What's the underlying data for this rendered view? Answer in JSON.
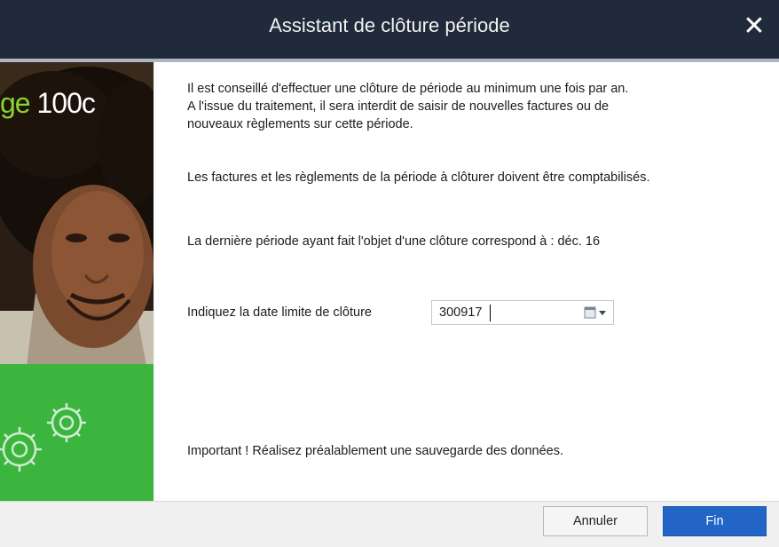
{
  "window": {
    "title": "Assistant de clôture période",
    "close_icon": "close-icon"
  },
  "sidebar": {
    "brand_accent": "ge",
    "brand_rest": " 100c",
    "accent_color": "#8bd42f",
    "panel_color": "#3cb53f"
  },
  "content": {
    "intro": "Il est conseillé d'effectuer une clôture de période au minimum une fois par an.\nA l'issue du traitement, il sera interdit de saisir de nouvelles factures ou de\nnouveaux règlements sur cette période.",
    "requirement": "Les factures et les règlements de la période à clôturer doivent être comptabilisés.",
    "last_closure": "La dernière période ayant fait l'objet d'une clôture correspond à : déc. 16",
    "date_label": "Indiquez la date limite de clôture",
    "date_value": "300917",
    "calendar_icon": "calendar-icon",
    "important": "Important ! Réalisez préalablement une sauvegarde des données."
  },
  "footer": {
    "cancel_label": "Annuler",
    "finish_label": "Fin",
    "primary_color": "#2265c6"
  }
}
